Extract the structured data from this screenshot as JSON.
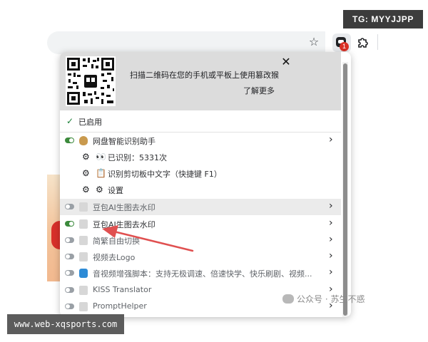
{
  "watermarks": {
    "top_right": "TG: MYYJJPP",
    "bottom_left": "www.web-xqsports.com",
    "bottom_right": "公众号 · 苏生不惑"
  },
  "toolbar": {
    "icons": [
      "star-icon",
      "tampermonkey-icon",
      "puzzle-icon"
    ],
    "extension_badge": "1",
    "badge_color": "#d93025"
  },
  "popup": {
    "promo": {
      "text": "扫描二维码在您的手机或平板上使用篡改猴",
      "link": "了解更多"
    },
    "enabled_label": "已启用",
    "scripts": [
      {
        "label": "网盘智能识别助手",
        "enabled": true,
        "icon": "pan-icon",
        "sub_items": [
          {
            "icon": "eyes-icon",
            "label": "已识别：5331次"
          },
          {
            "icon": "clipboard-icon",
            "label": "识别剪切板中文字（快捷键 F1）"
          },
          {
            "icon": "settings-icon",
            "label": "设置"
          }
        ]
      },
      {
        "label": "豆包AI生图去水印",
        "enabled": false,
        "icon": "doc-icon"
      },
      {
        "label": "豆包AI生图去水印",
        "enabled": true,
        "icon": "doc-icon"
      },
      {
        "label": "简繁自由切换",
        "enabled": false,
        "icon": "doc-icon"
      },
      {
        "label": "视频去Logo",
        "enabled": false,
        "icon": "doc-icon"
      },
      {
        "label": "音视频增强脚本：支持无极调速、倍速快学、快乐刷剧、视频...",
        "enabled": false,
        "icon": "audio-icon"
      },
      {
        "label": "KISS Translator",
        "enabled": false,
        "icon": "doc-icon"
      },
      {
        "label": "PromptHelper",
        "enabled": false,
        "icon": "doc-icon"
      }
    ],
    "accent_on": "#3c8a3c",
    "arrow_color": "#e05050"
  }
}
